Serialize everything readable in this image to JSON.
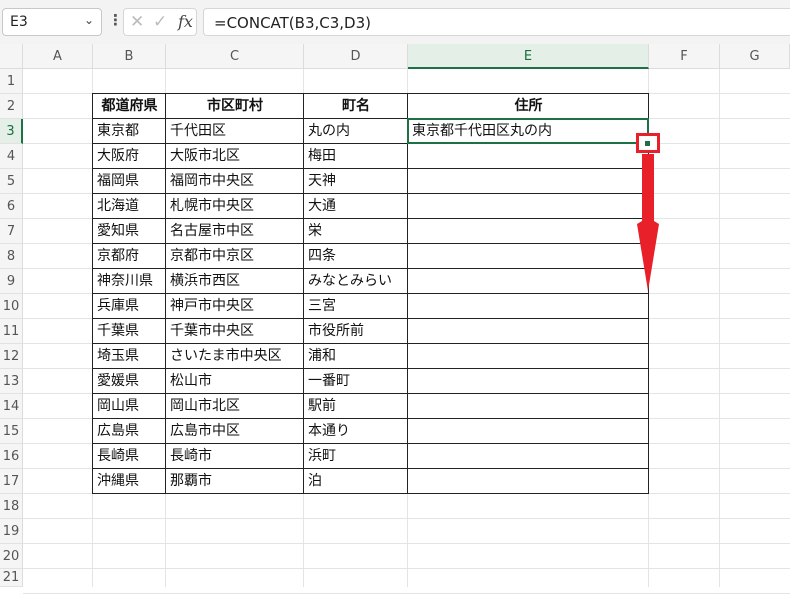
{
  "name_box": {
    "value": "E3"
  },
  "formula_bar": {
    "formula": "=CONCAT(B3,C3,D3)"
  },
  "columns": [
    "A",
    "B",
    "C",
    "D",
    "E",
    "F",
    "G"
  ],
  "rows": [
    "1",
    "2",
    "3",
    "4",
    "5",
    "6",
    "7",
    "8",
    "9",
    "10",
    "11",
    "12",
    "13",
    "14",
    "15",
    "16",
    "17",
    "18",
    "19",
    "20",
    "21"
  ],
  "table": {
    "headers": [
      "都道府県",
      "市区町村",
      "町名",
      "住所"
    ],
    "rows": [
      [
        "東京都",
        "千代田区",
        "丸の内",
        "東京都千代田区丸の内"
      ],
      [
        "大阪府",
        "大阪市北区",
        "梅田",
        ""
      ],
      [
        "福岡県",
        "福岡市中央区",
        "天神",
        ""
      ],
      [
        "北海道",
        "札幌市中央区",
        "大通",
        ""
      ],
      [
        "愛知県",
        "名古屋市中区",
        "栄",
        ""
      ],
      [
        "京都府",
        "京都市中京区",
        "四条",
        ""
      ],
      [
        "神奈川県",
        "横浜市西区",
        "みなとみらい",
        ""
      ],
      [
        "兵庫県",
        "神戸市中央区",
        "三宮",
        ""
      ],
      [
        "千葉県",
        "千葉市中央区",
        "市役所前",
        ""
      ],
      [
        "埼玉県",
        "さいたま市中央区",
        "浦和",
        ""
      ],
      [
        "愛媛県",
        "松山市",
        "一番町",
        ""
      ],
      [
        "岡山県",
        "岡山市北区",
        "駅前",
        ""
      ],
      [
        "広島県",
        "広島市中区",
        "本通り",
        ""
      ],
      [
        "長崎県",
        "長崎市",
        "浜町",
        ""
      ],
      [
        "沖縄県",
        "那覇市",
        "泊",
        ""
      ]
    ]
  },
  "colors": {
    "selection_green": "#1e7145",
    "annotation_red": "#e8202a"
  }
}
